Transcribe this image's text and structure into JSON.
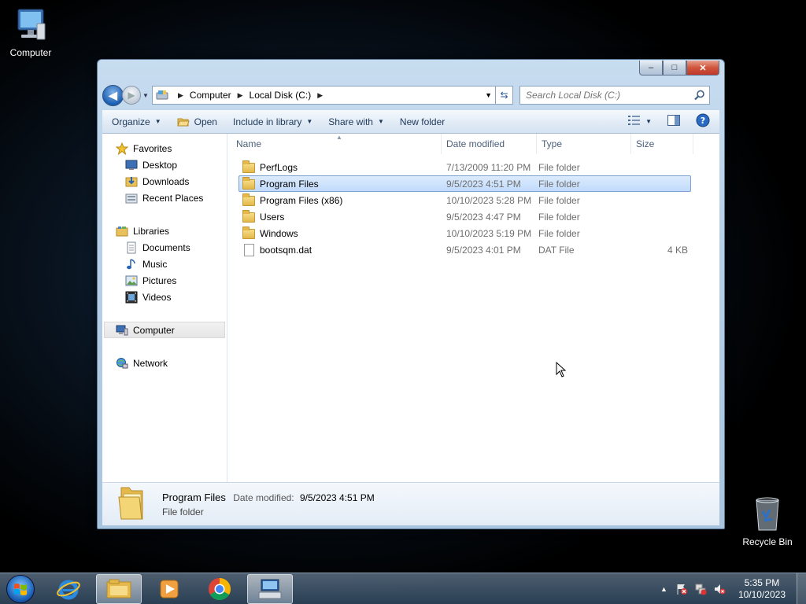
{
  "desktop": {
    "computer_label": "Computer",
    "recycle_label": "Recycle Bin"
  },
  "window": {
    "caption": {
      "minimize": "–",
      "maximize": "□",
      "close": "✕"
    },
    "address": {
      "crumbs": [
        "Computer",
        "Local Disk (C:)"
      ]
    },
    "search": {
      "placeholder": "Search Local Disk (C:)"
    },
    "toolbar": {
      "organize": "Organize",
      "open": "Open",
      "include": "Include in library",
      "share": "Share with",
      "new_folder": "New folder"
    },
    "nav": {
      "favorites": "Favorites",
      "desktop": "Desktop",
      "downloads": "Downloads",
      "recent": "Recent Places",
      "libraries": "Libraries",
      "documents": "Documents",
      "music": "Music",
      "pictures": "Pictures",
      "videos": "Videos",
      "computer": "Computer",
      "network": "Network"
    },
    "columns": {
      "name": "Name",
      "date": "Date modified",
      "type": "Type",
      "size": "Size"
    },
    "files": [
      {
        "name": "PerfLogs",
        "date": "7/13/2009 11:20 PM",
        "type": "File folder",
        "size": "",
        "kind": "folder"
      },
      {
        "name": "Program Files",
        "date": "9/5/2023 4:51 PM",
        "type": "File folder",
        "size": "",
        "kind": "folder",
        "selected": true
      },
      {
        "name": "Program Files (x86)",
        "date": "10/10/2023 5:28 PM",
        "type": "File folder",
        "size": "",
        "kind": "folder"
      },
      {
        "name": "Users",
        "date": "9/5/2023 4:47 PM",
        "type": "File folder",
        "size": "",
        "kind": "folder"
      },
      {
        "name": "Windows",
        "date": "10/10/2023 5:19 PM",
        "type": "File folder",
        "size": "",
        "kind": "folder"
      },
      {
        "name": "bootsqm.dat",
        "date": "9/5/2023 4:01 PM",
        "type": "DAT File",
        "size": "4 KB",
        "kind": "file"
      }
    ],
    "details": {
      "name": "Program Files",
      "date_label": "Date modified:",
      "date_value": "9/5/2023 4:51 PM",
      "type": "File folder"
    }
  },
  "taskbar": {
    "time": "5:35 PM",
    "date": "10/10/2023"
  }
}
